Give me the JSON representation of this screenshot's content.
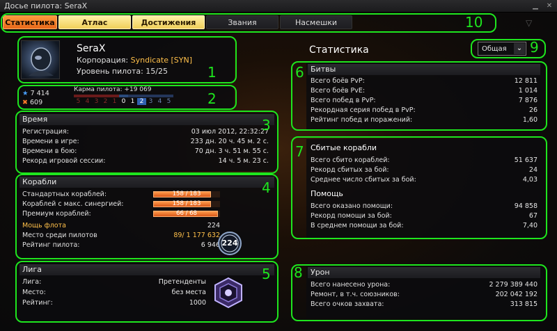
{
  "window": {
    "title": "Досье пилота: SeraX"
  },
  "tabs": [
    {
      "label": "Статистика",
      "state": "active"
    },
    {
      "label": "Атлас",
      "state": "gold"
    },
    {
      "label": "Достижения",
      "state": "gold"
    },
    {
      "label": "Звания",
      "state": "dark"
    },
    {
      "label": "Насмешки",
      "state": "dark"
    }
  ],
  "profile": {
    "name": "SeraX",
    "corp_label": "Корпорация:",
    "corp_value": "Syndicate [SYN]",
    "level_label": "Уровень пилота:",
    "level_value": "15/25"
  },
  "karma": {
    "stat1": "7 414",
    "stat2": "609",
    "label": "Карма пилота: +19 069",
    "neg": [
      "5",
      "4",
      "3",
      "2",
      "1"
    ],
    "zero": "0",
    "pos": [
      "1",
      "2",
      "3",
      "4",
      "5"
    ],
    "current_level": 2
  },
  "time": {
    "header": "Время",
    "rows": [
      {
        "label": "Регистрация:",
        "value": "03 июл 2012, 22:32:27"
      },
      {
        "label": "Времени в игре:",
        "value": "233 дн. 20 ч. 45 м. 2 с."
      },
      {
        "label": "Времени в бою:",
        "value": "70 дн. 3 ч. 51 м. 55 с."
      },
      {
        "label": "Рекорд игровой сессии:",
        "value": "14 ч. 5 м. 23 с."
      }
    ]
  },
  "ships": {
    "header": "Корабли",
    "bars": [
      {
        "label": "Стандартных кораблей:",
        "text": "158 / 183",
        "fraction": 0.863
      },
      {
        "label": "Кораблей с макс. синергией:",
        "text": "158 / 183",
        "fraction": 0.863
      },
      {
        "label": "Премиум кораблей:",
        "text": "66 / 68",
        "fraction": 0.97
      }
    ],
    "fleet_label": "Мощь флота",
    "fleet_value": "224",
    "place_label": "Место среди пилотов",
    "place_value": "89",
    "place_total": "/ 1 177 632",
    "rating_label": "Рейтинг пилота:",
    "rating_value": "6 946",
    "badge": "224"
  },
  "league": {
    "header": "Лига",
    "rows": [
      {
        "label": "Лига:",
        "value": "Претенденты"
      },
      {
        "label": "Место:",
        "value": "без места"
      },
      {
        "label": "Рейтинг:",
        "value": "1000"
      }
    ]
  },
  "stats_title": "Статистика",
  "dropdown": {
    "value": "Общая"
  },
  "battles": {
    "header": "Битвы",
    "rows": [
      {
        "label": "Всего боёв PvP:",
        "value": "12 811"
      },
      {
        "label": "Всего боёв PvE:",
        "value": "1 014"
      },
      {
        "label": "Всего побед в PvP:",
        "value": "7 876"
      },
      {
        "label": "Рекордная серия побед в PvP:",
        "value": "26"
      },
      {
        "label": "Рейтинг побед и поражений:",
        "value": "1,60"
      }
    ]
  },
  "kills": {
    "header": "Сбитые корабли",
    "rows": [
      {
        "label": "Всего сбито кораблей:",
        "value": "51 637"
      },
      {
        "label": "Рекорд сбитых за бой:",
        "value": "24"
      },
      {
        "label": "Среднее число сбитых за бой:",
        "value": "4,03"
      }
    ],
    "assist_header": "Помощь",
    "assist_rows": [
      {
        "label": "Всего оказано помощи:",
        "value": "94 858"
      },
      {
        "label": "Рекорд помощи за бой:",
        "value": "67"
      },
      {
        "label": "В среднем помощи за бой:",
        "value": "7,40"
      }
    ]
  },
  "damage": {
    "header": "Урон",
    "rows": [
      {
        "label": "Всего нанесено урона:",
        "value": "2 279 389 440"
      },
      {
        "label": "Ремонт, в т.ч. союзников:",
        "value": "202 042 192"
      },
      {
        "label": "Всего очков захвата:",
        "value": "313 815"
      }
    ]
  },
  "annotations": [
    "1",
    "2",
    "3",
    "4",
    "5",
    "6",
    "7",
    "8",
    "9",
    "10"
  ],
  "colors": {
    "accent": "#e8681a",
    "highlight": "#1ee61e",
    "gold": "#f0cf5a"
  }
}
